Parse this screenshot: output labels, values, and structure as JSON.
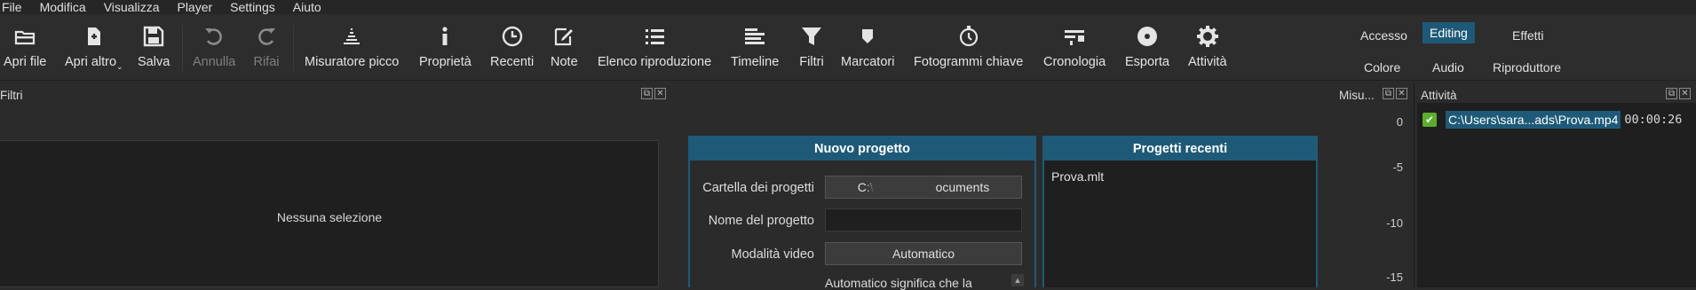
{
  "menu": {
    "items": [
      "File",
      "Modifica",
      "Visualizza",
      "Player",
      "Settings",
      "Aiuto"
    ]
  },
  "toolbar": {
    "buttons": [
      {
        "label": "Apri file",
        "icon": "folder-open-icon"
      },
      {
        "label": "Apri altro",
        "icon": "open-other-icon"
      },
      {
        "label": "Salva",
        "icon": "save-icon"
      },
      {
        "label": "Annulla",
        "icon": "undo-icon",
        "disabled": true
      },
      {
        "label": "Rifai",
        "icon": "redo-icon",
        "disabled": true
      },
      {
        "label": "Misuratore picco",
        "icon": "peak-meter-icon"
      },
      {
        "label": "Proprietà",
        "icon": "info-icon"
      },
      {
        "label": "Recenti",
        "icon": "clock-icon"
      },
      {
        "label": "Note",
        "icon": "note-icon"
      },
      {
        "label": "Elenco riproduzione",
        "icon": "playlist-icon"
      },
      {
        "label": "Timeline",
        "icon": "timeline-icon"
      },
      {
        "label": "Filtri",
        "icon": "filter-icon"
      },
      {
        "label": "Marcatori",
        "icon": "marker-icon"
      },
      {
        "label": "Fotogrammi chiave",
        "icon": "stopwatch-icon"
      },
      {
        "label": "Cronologia",
        "icon": "history-icon"
      },
      {
        "label": "Esporta",
        "icon": "disc-icon"
      },
      {
        "label": "Attività",
        "icon": "gear-icon"
      }
    ]
  },
  "layouts": {
    "row1": [
      "Accesso",
      "Editing",
      "Effetti"
    ],
    "row2": [
      "Colore",
      "Audio",
      "Riproduttore"
    ],
    "active": "Editing"
  },
  "filters_panel": {
    "title": "Filtri",
    "empty_message": "Nessuna selezione"
  },
  "new_project": {
    "title": "Nuovo progetto",
    "folder_label": "Cartella dei progetti",
    "folder_value_start": "C:\\",
    "folder_value_end": "ocuments",
    "name_label": "Nome del progetto",
    "name_value": "",
    "video_mode_label": "Modalità video",
    "video_mode_value": "Automatico",
    "note": "Automatico significa che la"
  },
  "recent_projects": {
    "title": "Progetti recenti",
    "items": [
      "Prova.mlt"
    ]
  },
  "meter": {
    "title": "Misu...",
    "ticks": [
      "0",
      "-5",
      "-10",
      "-15"
    ]
  },
  "activity": {
    "title": "Attività",
    "job_path": "C:\\Users\\sara...ads\\Prova.mp4",
    "job_time": "00:00:26"
  }
}
